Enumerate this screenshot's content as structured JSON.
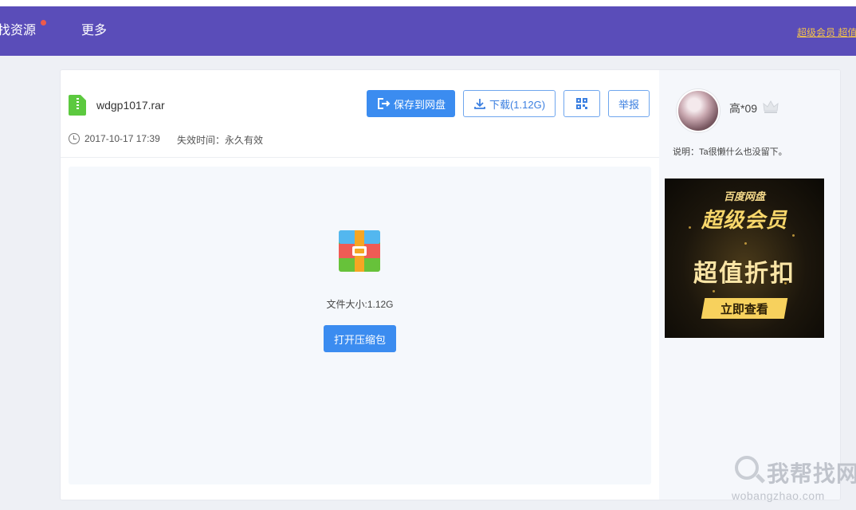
{
  "nav": {
    "find_resources": "找资源",
    "more": "更多",
    "vip_link": "超级会员 超值"
  },
  "file": {
    "name": "wdgp1017.rar",
    "date": "2017-10-17 17:39",
    "expire_label": "失效时间：",
    "expire_value": "永久有效"
  },
  "toolbar": {
    "save_label": "保存到网盘",
    "download_label": "下载(1.12G)",
    "report_label": "举报"
  },
  "preview": {
    "size_text": "文件大小:1.12G",
    "open_label": "打开压缩包"
  },
  "user": {
    "name": "高*09",
    "description": "说明：Ta很懒什么也没留下。"
  },
  "ad": {
    "brand": "百度网盘",
    "title": "超级会员",
    "slogan": "超值折扣",
    "button": "立即查看"
  },
  "watermark": {
    "cn": "我帮找网",
    "en": "wobangzhao.com"
  },
  "colors": {
    "nav_bg": "#5a4db9",
    "primary": "#3b8cf0",
    "vip_gold": "#f3c24b"
  }
}
